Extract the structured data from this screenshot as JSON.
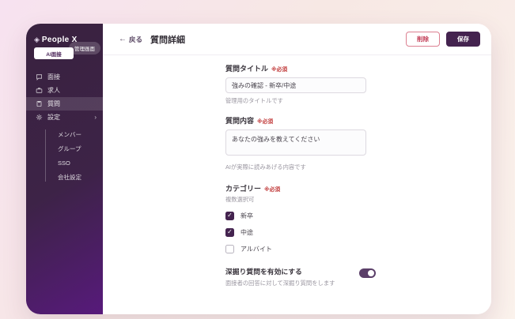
{
  "sidebar": {
    "logo_text": "People X",
    "logo_icon": "diamond-icon",
    "product_badge": "AI面接",
    "admin_badge": "管理画面",
    "items": [
      {
        "label": "面接",
        "icon": "chat-bubble-icon",
        "active": false
      },
      {
        "label": "求人",
        "icon": "briefcase-icon",
        "active": false
      },
      {
        "label": "質問",
        "icon": "clipboard-icon",
        "active": true
      },
      {
        "label": "設定",
        "icon": "gear-icon",
        "active": false,
        "chevron": "›"
      }
    ],
    "subitems": [
      {
        "label": "メンバー"
      },
      {
        "label": "グループ"
      },
      {
        "label": "SSO"
      },
      {
        "label": "会社設定"
      }
    ]
  },
  "header": {
    "back_icon": "arrow-left-icon",
    "back_arrow": "←",
    "back_label": "戻る",
    "title": "質問詳細",
    "delete_label": "削除",
    "save_label": "保存"
  },
  "form": {
    "required_badge": "※必須",
    "title_field": {
      "label": "質問タイトル",
      "value": "強みの確認 - 新卒/中途",
      "helper": "管理用のタイトルです"
    },
    "content_field": {
      "label": "質問内容",
      "value": "あなたの強みを教えてください",
      "helper": "AIが実際に読みあげる内容です"
    },
    "category": {
      "label": "カテゴリー",
      "helper": "複数選択可",
      "options": [
        {
          "label": "新卒",
          "checked": true
        },
        {
          "label": "中途",
          "checked": true
        },
        {
          "label": "アルバイト",
          "checked": false
        }
      ]
    },
    "followup": {
      "label": "深掘り質問を有効にする",
      "helper": "面接者の回答に対して深掘り質問をします",
      "enabled": true
    }
  },
  "colors": {
    "brand_dark_purple": "#44234f",
    "sidebar_gradient_start": "#39223f",
    "sidebar_gradient_end": "#571a7b",
    "danger_red": "#c23b55",
    "required_red": "#c13b3b",
    "page_gradient_pink": "#f7e2f0",
    "page_gradient_peach": "#fbf2ec"
  }
}
